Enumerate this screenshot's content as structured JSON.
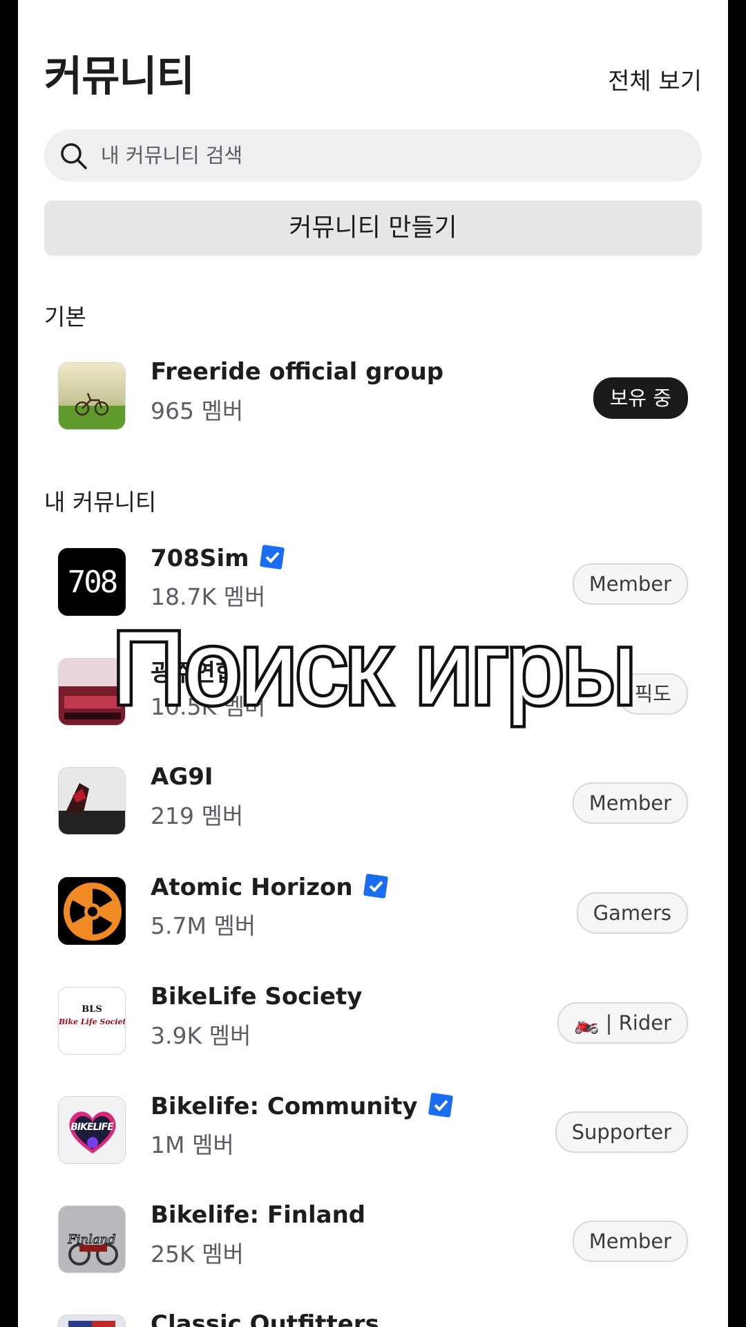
{
  "header": {
    "title": "커뮤니티",
    "view_all": "전체 보기"
  },
  "search": {
    "placeholder": "내 커뮤니티 검색"
  },
  "create_button": "커뮤니티 만들기",
  "sections": {
    "default": "기본",
    "mine": "내 커뮤니티"
  },
  "default_group": {
    "name": "Freeride official group",
    "members": "965 멤버",
    "role": "보유 중"
  },
  "communities": [
    {
      "name": "708Sim",
      "members": "18.7K 멤버",
      "role": "Member",
      "verified": true
    },
    {
      "name": "광주연합",
      "members": "10.5K 멤버",
      "role": "픽도",
      "verified": false
    },
    {
      "name": "AG9I",
      "members": "219 멤버",
      "role": "Member",
      "verified": false
    },
    {
      "name": "Atomic Horizon",
      "members": "5.7M 멤버",
      "role": "Gamers",
      "verified": true
    },
    {
      "name": "BikeLife Society",
      "members": "3.9K 멤버",
      "role": "🏍️ | Rider",
      "verified": false
    },
    {
      "name": "Bikelife: Community",
      "members": "1M 멤버",
      "role": "Supporter",
      "verified": true
    },
    {
      "name": "Bikelife: Finland",
      "members": "25K 멤버",
      "role": "Member",
      "verified": false
    },
    {
      "name": "Classic Outfitters",
      "members": "",
      "role": "",
      "verified": false
    }
  ],
  "thumb_text": {
    "sim708": "708",
    "bls": "BLS",
    "bls_sub": "Bike Life Society",
    "bikelife": "BIKELIFE",
    "finland": "Finland"
  },
  "overlay": "Поиск игры",
  "colors": {
    "verified": "#1a6cf0",
    "owner_badge": "#1a1a1c"
  }
}
